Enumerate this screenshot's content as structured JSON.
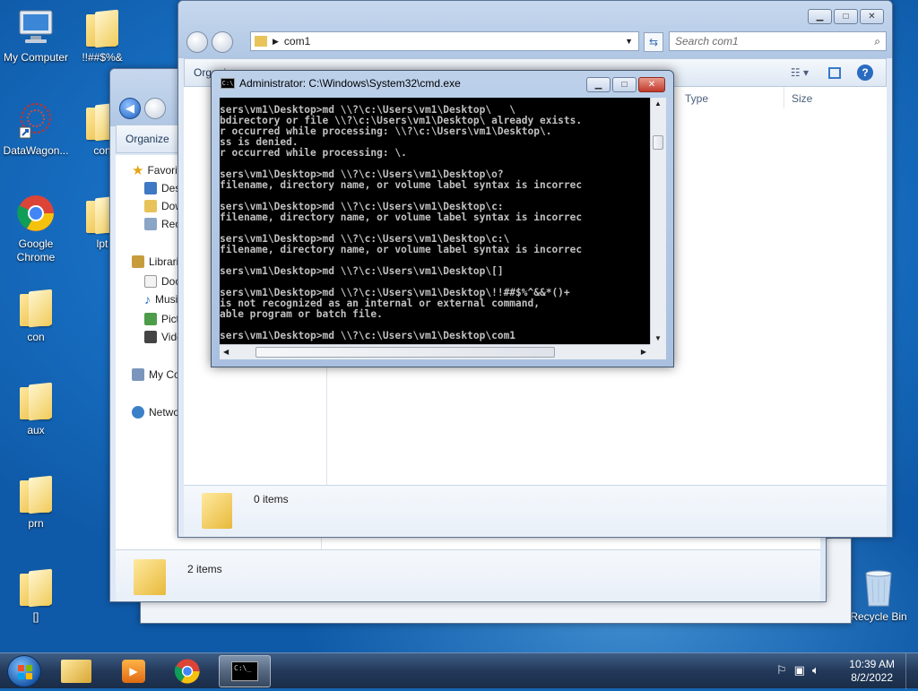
{
  "desktop_icons": [
    {
      "label": "My Computer",
      "icon": "computer-icon"
    },
    {
      "label": "!!##$%&",
      "icon": "folder-icon"
    },
    {
      "label": "DataWagon...",
      "icon": "shortcut-icon"
    },
    {
      "label": "con",
      "icon": "folder-icon"
    },
    {
      "label": "Google Chrome",
      "icon": "chrome-icon"
    },
    {
      "label": "lpt",
      "icon": "folder-icon"
    },
    {
      "label": "con",
      "icon": "file-icon"
    },
    {
      "label": "aux",
      "icon": "folder-icon"
    },
    {
      "label": "prn",
      "icon": "folder-icon"
    },
    {
      "label": "[]",
      "icon": "folder-icon"
    },
    {
      "label": "Recycle Bin",
      "icon": "recycle-bin-icon"
    }
  ],
  "explorer_back": {
    "address": "",
    "toolbar": {
      "organize": "Organize"
    },
    "nav": {
      "favorites": "Favorites",
      "desktop": "Desktop",
      "downloads": "Downloads",
      "recent": "Recent Places",
      "libraries": "Libraries",
      "documents": "Documents",
      "music": "Music",
      "pictures": "Pictures",
      "videos": "Videos",
      "computer": "My Computer",
      "network": "Network"
    },
    "status": "2 items"
  },
  "explorer_front": {
    "address": "com1",
    "search_placeholder": "Search com1",
    "toolbar": {
      "organize": "Organize"
    },
    "columns": {
      "type": "Type",
      "size": "Size"
    },
    "status": "0 items"
  },
  "cmd": {
    "title": "Administrator: C:\\Windows\\System32\\cmd.exe",
    "lines": [
      "sers\\vm1\\Desktop>md \\\\?\\c:\\Users\\vm1\\Desktop\\   \\",
      "bdirectory or file \\\\?\\c:\\Users\\vm1\\Desktop\\ already exists.",
      "r occurred while processing: \\\\?\\c:\\Users\\vm1\\Desktop\\.",
      "ss is denied.",
      "r occurred while processing: \\.",
      "",
      "sers\\vm1\\Desktop>md \\\\?\\c:\\Users\\vm1\\Desktop\\o?",
      "filename, directory name, or volume label syntax is incorrec",
      "",
      "sers\\vm1\\Desktop>md \\\\?\\c:\\Users\\vm1\\Desktop\\c:",
      "filename, directory name, or volume label syntax is incorrec",
      "",
      "sers\\vm1\\Desktop>md \\\\?\\c:\\Users\\vm1\\Desktop\\c:\\",
      "filename, directory name, or volume label syntax is incorrec",
      "",
      "sers\\vm1\\Desktop>md \\\\?\\c:\\Users\\vm1\\Desktop\\[]",
      "",
      "sers\\vm1\\Desktop>md \\\\?\\c:\\Users\\vm1\\Desktop\\!!##$%^&&*()+",
      "is not recognized as an internal or external command,",
      "able program or batch file.",
      "",
      "sers\\vm1\\Desktop>md \\\\?\\c:\\Users\\vm1\\Desktop\\com1"
    ]
  },
  "taskbar": {
    "time": "10:39 AM",
    "date": "8/2/2022"
  },
  "colors": {
    "accent": "#1a74c9",
    "cmd_bg": "#000000",
    "cmd_text": "#c0c0c0"
  }
}
